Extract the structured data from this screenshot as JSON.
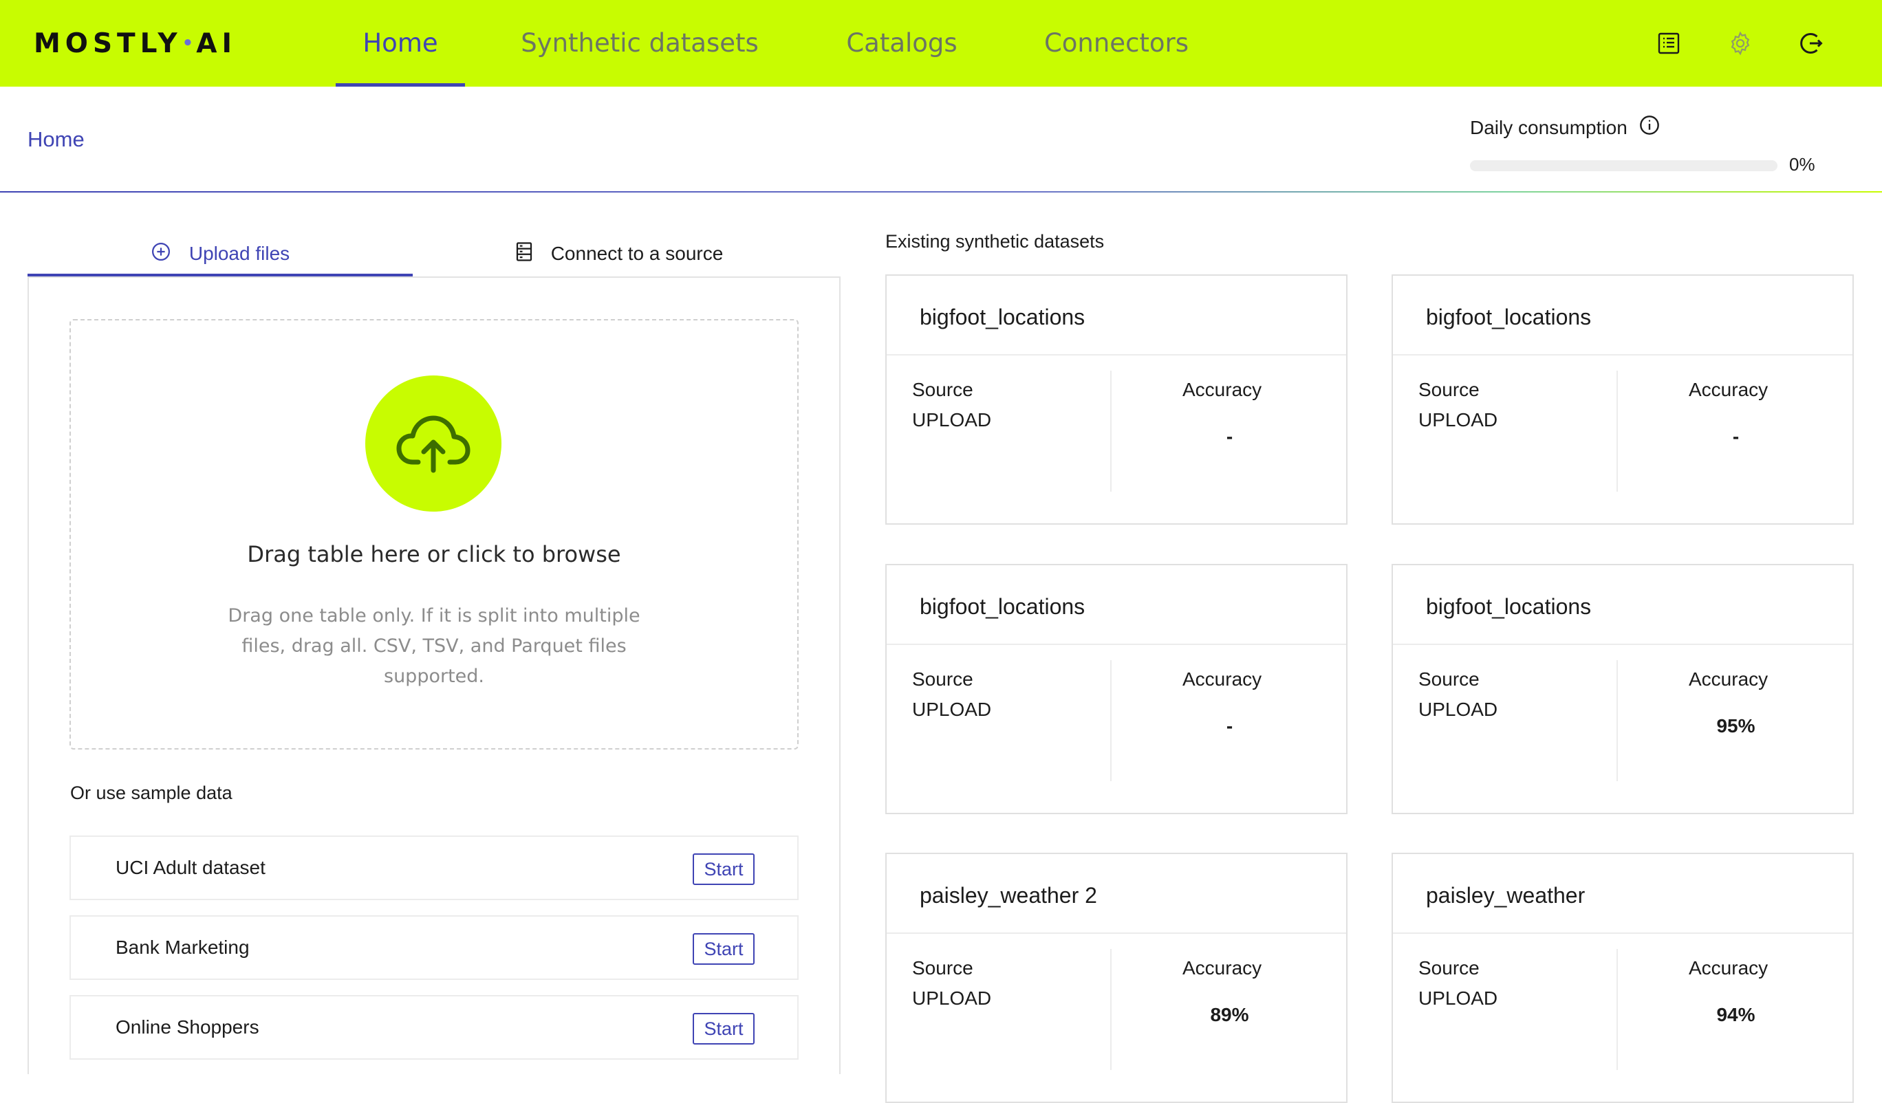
{
  "brand": {
    "logo_left": "MOSTLY",
    "logo_dot": "•",
    "logo_right": "AI",
    "accent": "#c8fc01",
    "primary": "#3f44b4"
  },
  "nav": {
    "tabs": [
      {
        "label": "Home",
        "active": true
      },
      {
        "label": "Synthetic datasets",
        "active": false
      },
      {
        "label": "Catalogs",
        "active": false
      },
      {
        "label": "Connectors",
        "active": false
      }
    ],
    "icons": [
      "docs-icon",
      "gear-icon",
      "logout-icon"
    ]
  },
  "breadcrumb": {
    "current": "Home"
  },
  "consumption": {
    "label": "Daily consumption",
    "percent_text": "0%",
    "percent": 0
  },
  "left": {
    "tabs": {
      "upload": "Upload files",
      "connect": "Connect to a source"
    },
    "dropzone": {
      "title": "Drag table here or click to browse",
      "hint": "Drag one table only. If it is split into multiple files, drag all. CSV, TSV, and Parquet files supported."
    },
    "sample_title": "Or use sample data",
    "samples": [
      {
        "name": "UCI Adult dataset",
        "action": "Start"
      },
      {
        "name": "Bank Marketing",
        "action": "Start"
      },
      {
        "name": "Online Shoppers",
        "action": "Start"
      }
    ]
  },
  "right": {
    "title": "Existing synthetic datasets",
    "source_label": "Source",
    "accuracy_label": "Accuracy",
    "datasets": [
      {
        "name": "bigfoot_locations",
        "source": "UPLOAD",
        "accuracy": "-"
      },
      {
        "name": "bigfoot_locations",
        "source": "UPLOAD",
        "accuracy": "-"
      },
      {
        "name": "bigfoot_locations",
        "source": "UPLOAD",
        "accuracy": "-"
      },
      {
        "name": "bigfoot_locations",
        "source": "UPLOAD",
        "accuracy": "95%"
      },
      {
        "name": "paisley_weather 2",
        "source": "UPLOAD",
        "accuracy": "89%"
      },
      {
        "name": "paisley_weather",
        "source": "UPLOAD",
        "accuracy": "94%"
      }
    ]
  }
}
